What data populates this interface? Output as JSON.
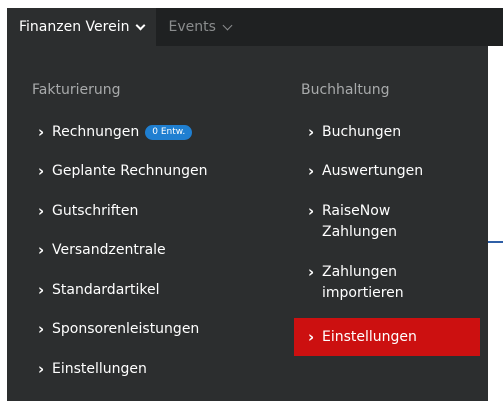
{
  "topbar": {
    "tabs": [
      {
        "label": "Finanzen Verein",
        "active": true
      },
      {
        "label": "Events",
        "active": false
      }
    ]
  },
  "menu": {
    "left": {
      "title": "Fakturierung",
      "items": [
        {
          "label": "Rechnungen",
          "badge": "0 Entw."
        },
        {
          "label": "Geplante Rechnungen"
        },
        {
          "label": "Gutschriften"
        },
        {
          "label": "Versandzentrale"
        },
        {
          "label": "Standardartikel"
        },
        {
          "label": "Sponsorenleistungen"
        },
        {
          "label": "Einstellungen"
        }
      ]
    },
    "right": {
      "title": "Buchhaltung",
      "items": [
        {
          "label": "Buchungen"
        },
        {
          "label": "Auswertungen"
        },
        {
          "label_line1": "RaiseNow",
          "label_line2": "Zahlungen"
        },
        {
          "label_line1": "Zahlungen",
          "label_line2": "importieren"
        },
        {
          "label": "Einstellungen",
          "highlighted": true
        }
      ]
    }
  },
  "icons": {
    "caret": "chevron-right-icon",
    "dropdown": "chevron-down-icon"
  },
  "colors": {
    "topbar": "#1f2122",
    "panel": "#2c2e2f",
    "highlight": "#cc1010",
    "badge": "#1f7fd1",
    "title_text": "#a8aaab"
  }
}
